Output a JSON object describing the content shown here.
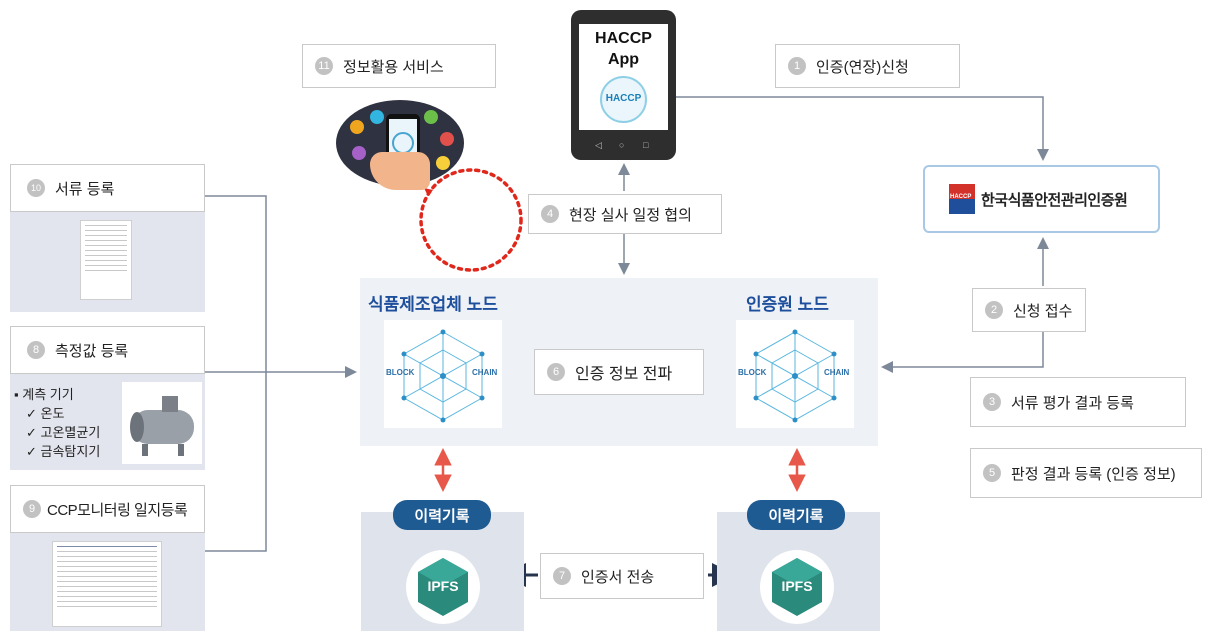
{
  "app": {
    "title": "HACCP",
    "subtitle": "App",
    "badge_text": "HACCP"
  },
  "agency": {
    "name": "한국식품안전관리인증원",
    "logo_text": "HACCP"
  },
  "steps": {
    "s1": {
      "num": "1",
      "label": "인증(연장)신청"
    },
    "s2": {
      "num": "2",
      "label": "신청 접수"
    },
    "s3": {
      "num": "3",
      "label": "서류 평가 결과 등록"
    },
    "s4": {
      "num": "4",
      "label": "현장 실사 일정 협의"
    },
    "s5": {
      "num": "5",
      "label": "판정 결과 등록 (인증 정보)"
    },
    "s6": {
      "num": "6",
      "label": "인증 정보 전파"
    },
    "s7": {
      "num": "7",
      "label": "인증서 전송"
    },
    "s8": {
      "num": "8",
      "label": "측정값 등록"
    },
    "s9": {
      "num": "9",
      "label": "CCP모니터링 일지등록"
    },
    "s10": {
      "num": "10",
      "label": "서류 등록"
    },
    "s11": {
      "num": "11",
      "label": "정보활용 서비스"
    }
  },
  "measurement": {
    "title": "계측 기기",
    "items": [
      "온도",
      "고온멸균기",
      "금속탐지기"
    ]
  },
  "nodes": {
    "manufacturer": {
      "title": "식품제조업체 노드",
      "left_word": "BLOCK",
      "right_word": "CHAIN"
    },
    "certifier": {
      "title": "인증원 노드",
      "left_word": "BLOCK",
      "right_word": "CHAIN"
    }
  },
  "history": {
    "left_label": "이력기록",
    "right_label": "이력기록",
    "ipfs_text": "IPFS"
  },
  "colors": {
    "node_title": "#1e4f9c",
    "pill": "#1f5b93",
    "ipfs": "#2a8a7c",
    "dashed_circle": "#e0271c",
    "red_arrow": "#e8584a"
  }
}
